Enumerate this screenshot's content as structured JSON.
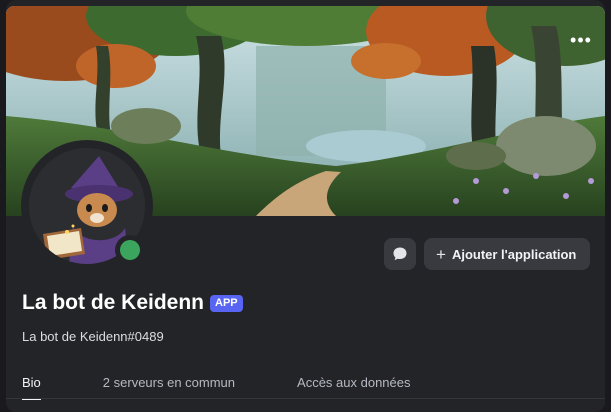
{
  "profile": {
    "name": "La bot de Keidenn",
    "badge": "APP",
    "tag": "La bot de Keidenn#0489",
    "status_color": "#3ba55d"
  },
  "actions": {
    "message_icon": "chat-bubble-icon",
    "add_app_icon": "plus-icon",
    "add_app_label": "Ajouter l'application",
    "more_icon": "more-horizontal-icon"
  },
  "tabs": [
    {
      "label": "Bio",
      "active": true
    },
    {
      "label": "2 serveurs en commun",
      "active": false
    },
    {
      "label": "Accès aux données",
      "active": false
    }
  ],
  "colors": {
    "background": "#232428",
    "accent": "#5865f2",
    "button": "#383a40"
  }
}
